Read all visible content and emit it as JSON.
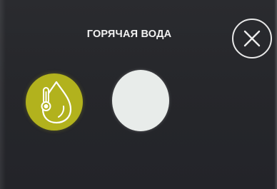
{
  "screen": {
    "title": "ГОРЯЧАЯ ВОДА"
  },
  "icons": {
    "close": "close-icon",
    "hot_water": "thermometer-droplet-icon"
  },
  "colors": {
    "background": "#26272b",
    "active_mode": "#b2b21d",
    "inactive_mode": "#e8ecea",
    "text": "#f2f2f2"
  },
  "modes": [
    {
      "id": "hot-water",
      "selected": true
    },
    {
      "id": "second-option",
      "selected": false
    }
  ]
}
